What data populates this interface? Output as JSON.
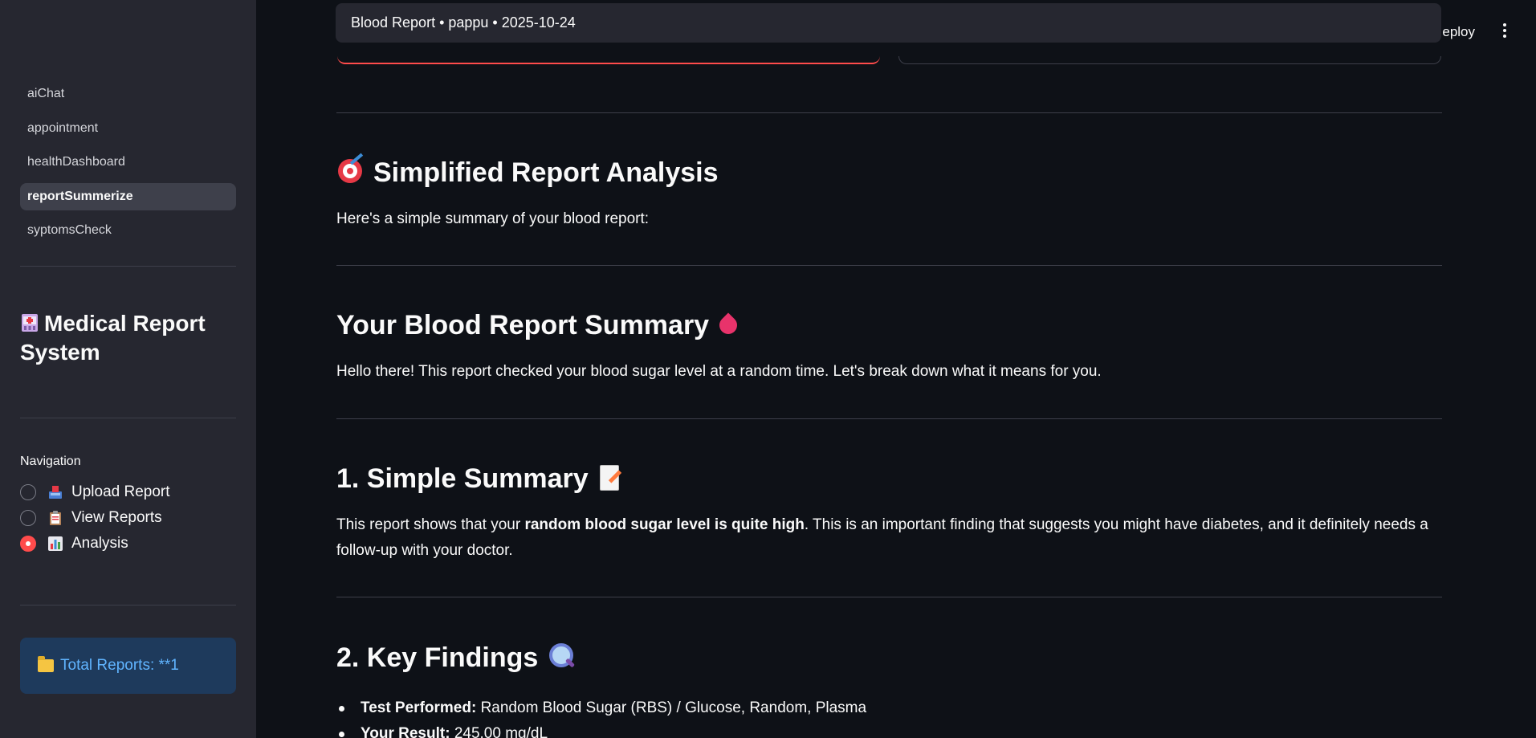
{
  "sidebar": {
    "pages": [
      {
        "label": "aiChat",
        "active": false
      },
      {
        "label": "appointment",
        "active": false
      },
      {
        "label": "healthDashboard",
        "active": false
      },
      {
        "label": "reportSummerize",
        "active": true
      },
      {
        "label": "syptomsCheck",
        "active": false
      }
    ],
    "title": "Medical Report System",
    "title_icon": "hospital-icon",
    "navigation_label": "Navigation",
    "radio_options": [
      {
        "label": "Upload Report",
        "icon": "inbox-tray-icon",
        "checked": false
      },
      {
        "label": "View Reports",
        "icon": "clipboard-icon",
        "checked": false
      },
      {
        "label": "Analysis",
        "icon": "bar-chart-icon",
        "checked": true
      }
    ],
    "info_box": {
      "icon": "folder-icon",
      "text": "Total Reports: **1"
    }
  },
  "header": {
    "toast_title": "Blood Report • pappu • 2025-10-24",
    "deploy_label": "eploy"
  },
  "main": {
    "analysis_heading": "Simplified Report Analysis",
    "analysis_intro": "Here's a simple summary of your blood report:",
    "summary_heading": "Your Blood Report Summary",
    "summary_intro": "Hello there! This report checked your blood sugar level at a random time. Let's break down what it means for you.",
    "simple_summary_heading": "1. Simple Summary",
    "simple_summary_pre": "This report shows that your ",
    "simple_summary_bold": "random blood sugar level is quite high",
    "simple_summary_post": ". This is an important finding that suggests you might have diabetes, and it definitely needs a follow-up with your doctor.",
    "key_findings_heading": "2. Key Findings",
    "findings": [
      {
        "label": "Test Performed:",
        "value": " Random Blood Sugar (RBS) / Glucose, Random, Plasma"
      },
      {
        "label": "Your Result:",
        "value": " 245.00 mg/dL"
      }
    ]
  },
  "colors": {
    "accent": "#ff4b4b",
    "background": "#0e1117",
    "sidebar": "#262730",
    "info": "#60b4ff"
  }
}
